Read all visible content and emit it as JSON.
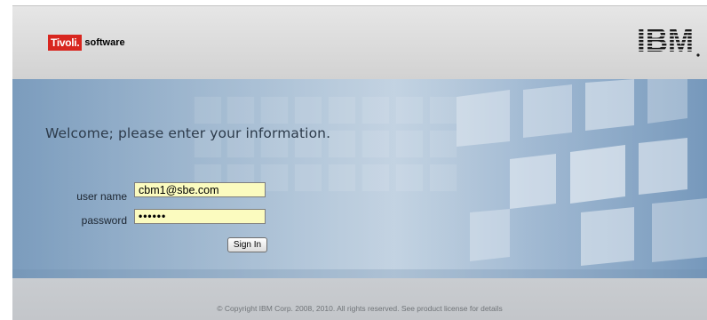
{
  "header": {
    "brand_box": "Tivoli.",
    "brand_word": "software",
    "company_logo": "IBM"
  },
  "login": {
    "welcome": "Welcome; please enter your information.",
    "username_label": "user name",
    "username_value": "cbm1@sbe.com",
    "password_label": "password",
    "password_value": "••••••",
    "signin_label": "Sign In"
  },
  "footer": {
    "copyright": "© Copyright IBM Corp. 2008, 2010. All rights reserved. See product license for details"
  },
  "colors": {
    "tivoli_red": "#d8261f",
    "field_background": "#fbfbbf",
    "hero_blue": "#8facca"
  }
}
